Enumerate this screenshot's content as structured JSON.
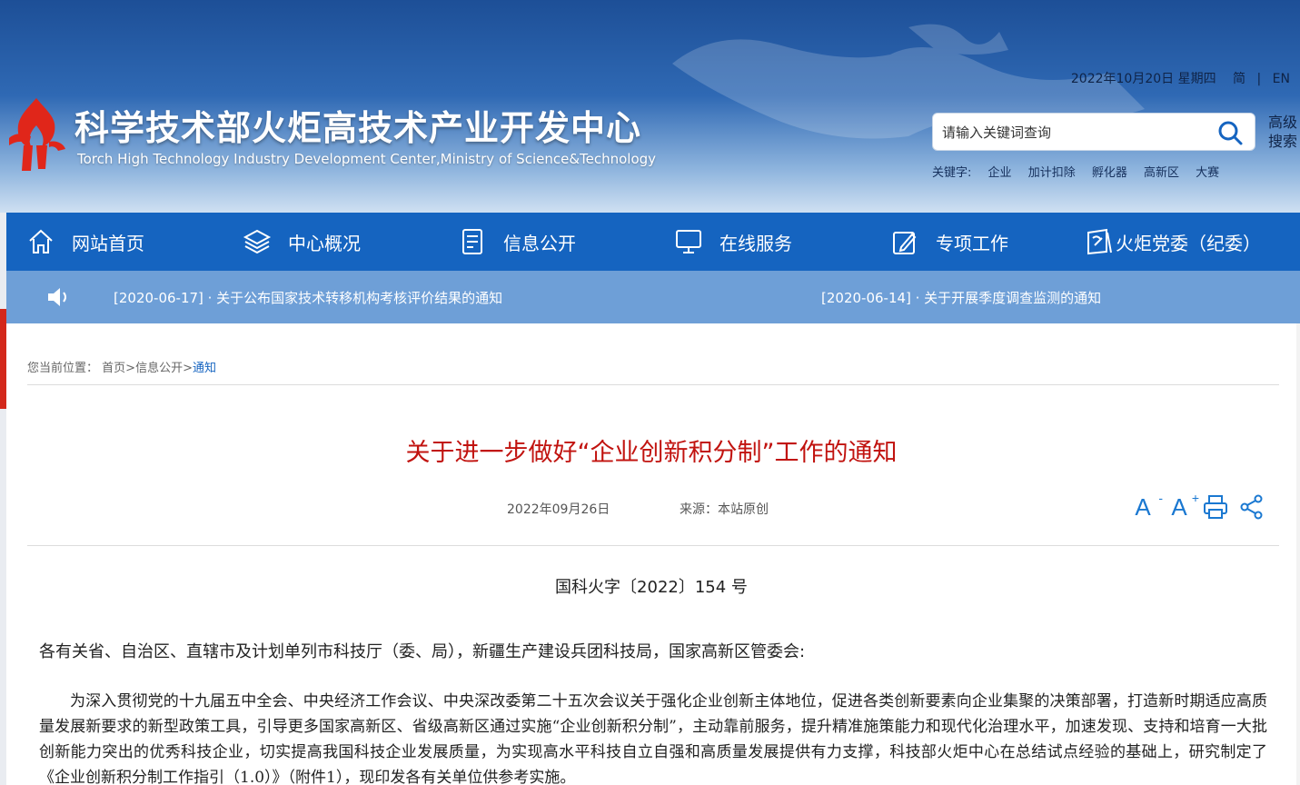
{
  "header": {
    "title": "科学技术部火炬高技术产业开发中心",
    "subtitle": "Torch High Technology Industry Development Center,Ministry of Science&Technology",
    "date": "2022年10月20日 星期四",
    "lang_simplified": "简",
    "lang_sep": "|",
    "lang_english": "EN",
    "search_placeholder": "请输入关键词查询",
    "advanced_search": "高级搜索",
    "keywords_label": "关键字:",
    "keywords": [
      "企业",
      "加计扣除",
      "孵化器",
      "高新区",
      "大赛"
    ]
  },
  "nav": {
    "items": [
      {
        "label": "网站首页",
        "icon": "home-icon"
      },
      {
        "label": "中心概况",
        "icon": "layers-icon"
      },
      {
        "label": "信息公开",
        "icon": "document-icon"
      },
      {
        "label": "在线服务",
        "icon": "monitor-icon"
      },
      {
        "label": "专项工作",
        "icon": "clipboard-pen-icon"
      },
      {
        "label": "火炬党委（纪委）",
        "icon": "party-icon"
      }
    ]
  },
  "ticker": {
    "items": [
      "[2020-06-17] · 关于公布国家技术转移机构考核评价结果的通知",
      "[2020-06-14] · 关于开展季度调查监测的通知"
    ]
  },
  "breadcrumb": {
    "label": "您当前位置：",
    "home": "首页",
    "sep1": ">",
    "section": "信息公开",
    "sep2": ">",
    "current": "通知"
  },
  "article": {
    "title": "关于进一步做好“企业创新积分制”工作的通知",
    "date": "2022年09月26日",
    "source": "来源：本站原创",
    "doc_number": "国科火字〔2022〕154 号",
    "addressee": "各有关省、自治区、直辖市及计划单列市科技厅（委、局），新疆生产建设兵团科技局，国家高新区管委会:",
    "body": "为深入贯彻党的十九届五中全会、中央经济工作会议、中央深改委第二十五次会议关于强化企业创新主体地位，促进各类创新要素向企业集聚的决策部署，打造新时期适应高质量发展新要求的新型政策工具，引导更多国家高新区、省级高新区通过实施“企业创新积分制”，主动靠前服务，提升精准施策能力和现代化治理水平，加速发现、支持和培育一大批创新能力突出的优秀科技企业，切实提高我国科技企业发展质量，为实现高水平科技自立自强和高质量发展提供有力支撑，科技部火炬中心在总结试点经验的基础上，研究制定了《企业创新积分制工作指引（1.0）》（附件1），现印发各有关单位供参考实施。"
  },
  "tools": {
    "font_decrease": "A",
    "font_increase": "A"
  },
  "colors": {
    "nav_bg": "#1564c0",
    "ticker_bg": "#6e9fd7",
    "title_red": "#c1130f",
    "link_blue": "#1564c0"
  }
}
